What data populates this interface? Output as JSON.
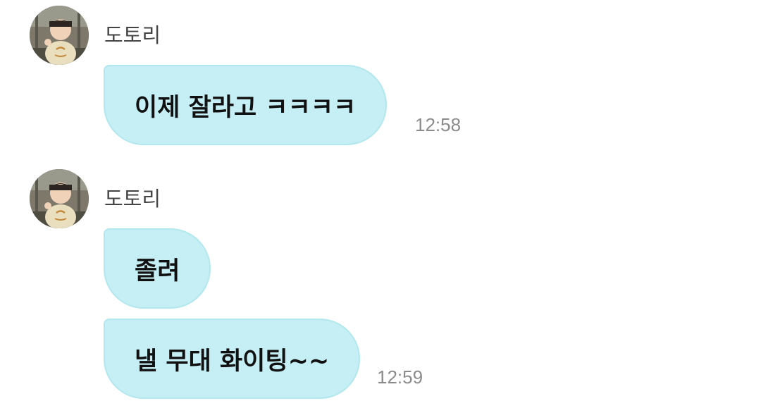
{
  "messages": [
    {
      "sender": "도토리",
      "bubbles": [
        "이제 잘라고 ㅋㅋㅋㅋ"
      ],
      "time": "12:58"
    },
    {
      "sender": "도토리",
      "bubbles": [
        "졸려",
        "낼 무대 화이팅~~"
      ],
      "time": "12:59"
    }
  ],
  "colors": {
    "bubble_background": "#c5eff4",
    "bubble_border": "#b2e7ee",
    "time_text": "#8b8b8b",
    "sender_text": "#444444"
  },
  "icons": {
    "avatar": "profile-photo-child-icon"
  }
}
